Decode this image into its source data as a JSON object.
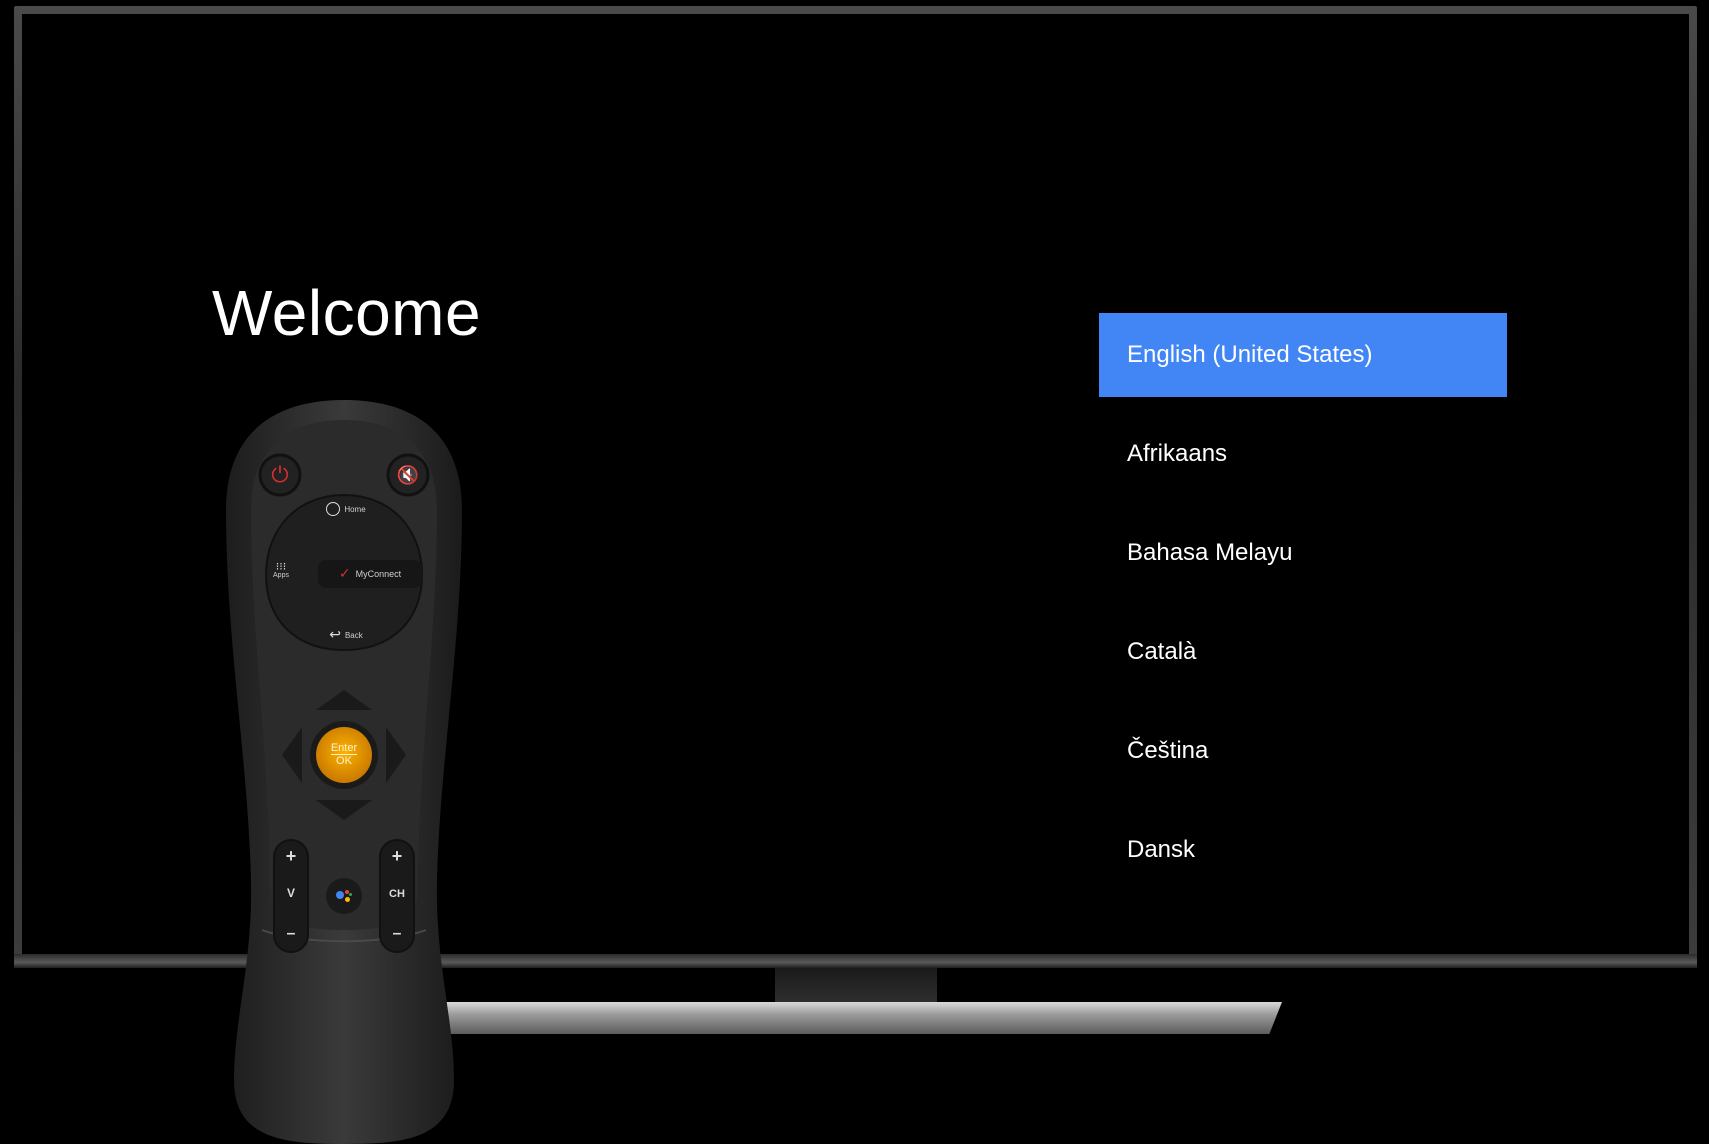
{
  "screen": {
    "title": "Welcome",
    "languages": [
      {
        "label": "English (United States)",
        "selected": true
      },
      {
        "label": "Afrikaans",
        "selected": false
      },
      {
        "label": "Bahasa Melayu",
        "selected": false
      },
      {
        "label": "Català",
        "selected": false
      },
      {
        "label": "Čeština",
        "selected": false
      },
      {
        "label": "Dansk",
        "selected": false
      }
    ],
    "accent_color": "#4285f4"
  },
  "remote": {
    "home_label": "Home",
    "apps_label": "Apps",
    "myconnect_label": "MyConnect",
    "back_label": "Back",
    "enter_label": "Enter",
    "ok_label": "OK",
    "volume_label": "V",
    "channel_label": "CH",
    "plus_symbol": "+",
    "minus_symbol": "–",
    "icons": [
      "power-icon",
      "mute-icon",
      "home-icon",
      "apps-grid-icon",
      "myconnect-icon",
      "back-icon",
      "assistant-icon"
    ],
    "colors": {
      "power": "#d32f2f",
      "mute": "#2e9d4a",
      "enter": "#f5a300"
    }
  }
}
